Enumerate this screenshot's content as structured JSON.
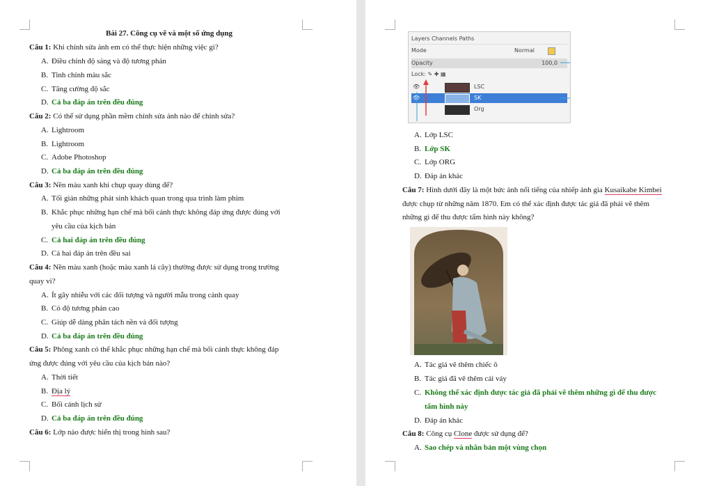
{
  "page1": {
    "title": "Bài 27. Công cụ vẽ và một số ứng dụng",
    "q1": {
      "label": "Câu 1:",
      "text": "Khi chỉnh sửa ảnh em có thể thực hiện những việc gì?",
      "options": [
        "Điều chỉnh độ sáng và độ tương phản",
        "Tinh chỉnh màu sắc",
        "Tăng cường độ sắc",
        "Cả ba đáp án trên đều đúng"
      ]
    },
    "q2": {
      "label": "Câu 2:",
      "text": "Có thể sử dụng phần mềm chỉnh sửa ảnh nào để chỉnh sửa?",
      "options": [
        "Lightroom",
        "Lightroom",
        "Adobe Photoshop",
        "Cả ba đáp án trên đều đúng"
      ]
    },
    "q3": {
      "label": "Câu 3:",
      "text": "Nền màu xanh khi chụp quay dùng để?",
      "options": [
        "Tối giản những phát sinh khách quan trong qua trình làm phim",
        "Khắc phục những hạn chế mà bối cảnh thực không đáp ứng được đúng với",
        "yêu cầu của kịch bản",
        "Cả hai đáp án trên đều đúng",
        "Cả hai đáp án trên đều sai"
      ]
    },
    "q4": {
      "label": "Câu 4:",
      "text1": "Nền màu xanh (hoặc màu xanh lá cây) thường được sử dụng trong trường",
      "text2": "quay vì?",
      "options": [
        "Ít gây nhiễu với các đối tượng và người mẫu trong cảnh quay",
        "Có độ tương phản cao",
        "Giúp dễ dàng phân tách nền và đối tượng",
        "Cả ba đáp án trên đều đúng"
      ]
    },
    "q5": {
      "label": "Câu 5:",
      "text1": "Phông xanh có thể khắc phục những hạn chế mà bối cảnh thực không đáp",
      "text2": "ứng được đúng với yêu cầu của kịch bản nào?",
      "options": [
        "Thời tiết",
        "Địa lý",
        "Bối cảnh lịch sử",
        "Cả ba đáp án trên đều đúng"
      ]
    },
    "q6": {
      "label": "Câu 6:",
      "text": "Lớp nào được hiển thị trong hình sau?"
    }
  },
  "letters": [
    "A.",
    "B.",
    "C.",
    "D."
  ],
  "gimp": {
    "tabs": "Layers  Channels  Paths",
    "mode_label": "Mode",
    "mode_value": "Normal",
    "opacity_label": "Opacity",
    "opacity_value": "100,0",
    "lock_label": "Lock:",
    "layers": [
      "LSC",
      "SK",
      "Org"
    ]
  },
  "page2": {
    "q6_options": [
      "Lớp LSC",
      "Lớp SK",
      "Lớp ORG",
      "Đáp án khác"
    ],
    "q7": {
      "label": "Câu 7:",
      "text1": "Hình dưới đây là một bức ảnh nổi tiếng của nhiếp ảnh gia",
      "name": "Kusaikabe Kimbei",
      "text2": "được chụp từ những năm 1870. Em có thể xác định được tác giả đã phải vẽ thêm",
      "text3": "những gì để thu được tấm hình này không?",
      "options": [
        "Tác giả vẽ thêm chiếc ô",
        "Tác giả đã vẽ thêm cái váy",
        "Không thể xác định được tác giả đã phải vẽ thêm những gì để thu được",
        "tấm hình này",
        "Đáp án khác"
      ]
    },
    "q8": {
      "label": "Câu 8:",
      "pre": "Công cụ",
      "tool": "Clone",
      "post": "được sử dụng để?",
      "options": [
        "Sao chép và nhân bản một vùng chọn"
      ]
    }
  },
  "colors": {
    "correct": "#1a7a1a",
    "spellcheck": "#e23c60",
    "layer_selected": "#3d7ed6"
  }
}
